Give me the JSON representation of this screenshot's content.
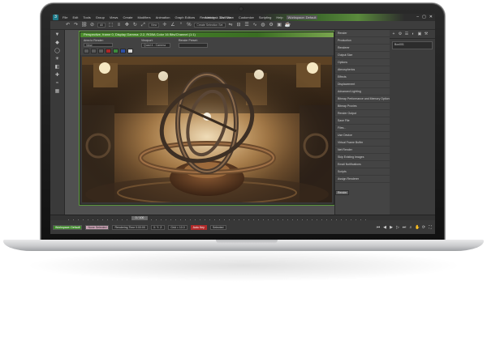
{
  "app": {
    "window_title": "Autodesk 3ds Max",
    "workspace": "Workspace: Default",
    "menu": [
      "File",
      "Edit",
      "Tools",
      "Group",
      "Views",
      "Create",
      "Modifiers",
      "Animation",
      "Graph Editors",
      "Rendering",
      "Civil View",
      "Customize",
      "Scripting",
      "Help"
    ]
  },
  "toolbar": {
    "selection_filter": "All",
    "view_dropdown": "View",
    "selection_set": "Create Selection Set"
  },
  "render_frame": {
    "title": "Perspective, frame 0, Display Gamma: 2.2, RGBA Color 16 Bits/Channel (1:1)",
    "area_label": "Area to Render:",
    "area_value": "View",
    "viewport_label": "Viewport:",
    "viewport_value": "Quad 4 - Camera",
    "preset_label": "Render Preset:",
    "preset_value": "",
    "image_subject": "armillary sphere render"
  },
  "properties": {
    "rows": [
      "Render",
      "Production",
      "Renderer",
      "Output Size",
      "Options",
      "Atmospherics",
      "Effects",
      "Displacement",
      "Advanced Lighting",
      "Bitmap Performance and Memory Options",
      "Bitmap Proxies",
      "Render Output",
      "Save File",
      "Files...",
      "Use Device",
      "Virtual Frame Buffer",
      "Net Render",
      "Skip Existing Images",
      "Email Notifications",
      "Scripts",
      "Assign Renderer"
    ],
    "render_button": "Render"
  },
  "command_panel": {
    "tabs": [
      "+",
      "⚙",
      "☰",
      "◐",
      "▣",
      "⚒"
    ],
    "object_field": "Box001"
  },
  "timeline": {
    "frame_counter": "0 / 100"
  },
  "status": {
    "workspace_label": "Workspace: Default",
    "selection_info": "None Selected",
    "prompt": "Rendering Time  0:00:00",
    "coords": "X:   Y:   Z:",
    "grid": "Grid = 10.0",
    "auto_key": "Auto Key",
    "selected_label": "Selected",
    "set_key": "Set Key",
    "key_filters": "Key Filters..."
  },
  "colors": {
    "accent_green": "#4c8c2e",
    "ui_dark": "#3d3d3d",
    "key_red": "#b12a2a"
  }
}
